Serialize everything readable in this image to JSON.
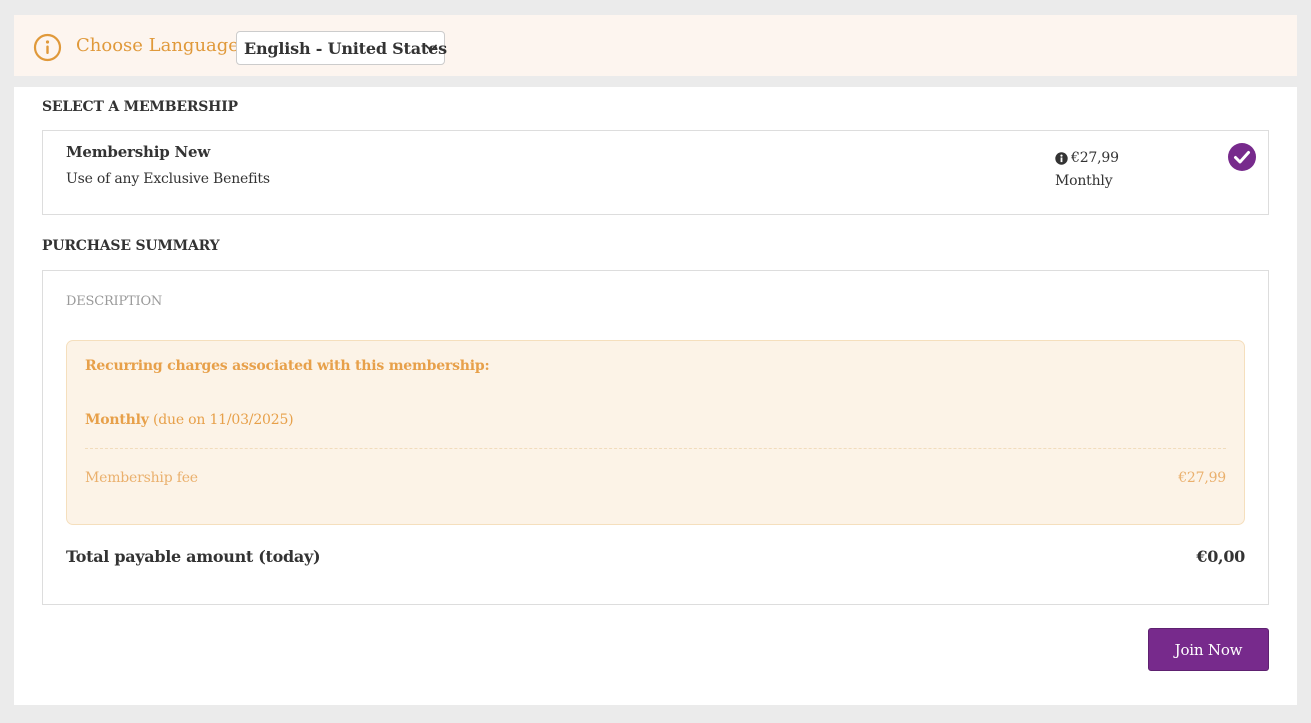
{
  "language_bar": {
    "label": "Choose Language",
    "selected_language": "English - United States",
    "icon": "info-circle-icon",
    "colors": {
      "background": "#fdf5ef",
      "accent": "#e0993a"
    }
  },
  "membership_section": {
    "title": "SELECT A MEMBERSHIP",
    "selected_membership": {
      "name": "Membership New",
      "description": "Use of any Exclusive Benefits",
      "price": "€27,99",
      "period": "Monthly",
      "selected": true,
      "price_icon": "info-circle-icon",
      "selected_icon": "check-circle-icon"
    }
  },
  "purchase_summary": {
    "title": "PURCHASE SUMMARY",
    "description_label": "DESCRIPTION",
    "recurring_charges": {
      "heading": "Recurring charges associated with this membership:",
      "period": "Monthly",
      "due_text": "(due on 11/03/2025)",
      "line_items": [
        {
          "label": "Membership fee",
          "amount": "€27,99"
        }
      ]
    },
    "total": {
      "label": "Total payable amount (today)",
      "amount": "€0,00"
    }
  },
  "actions": {
    "join_label": "Join Now",
    "colors": {
      "button": "#772a8c"
    }
  }
}
